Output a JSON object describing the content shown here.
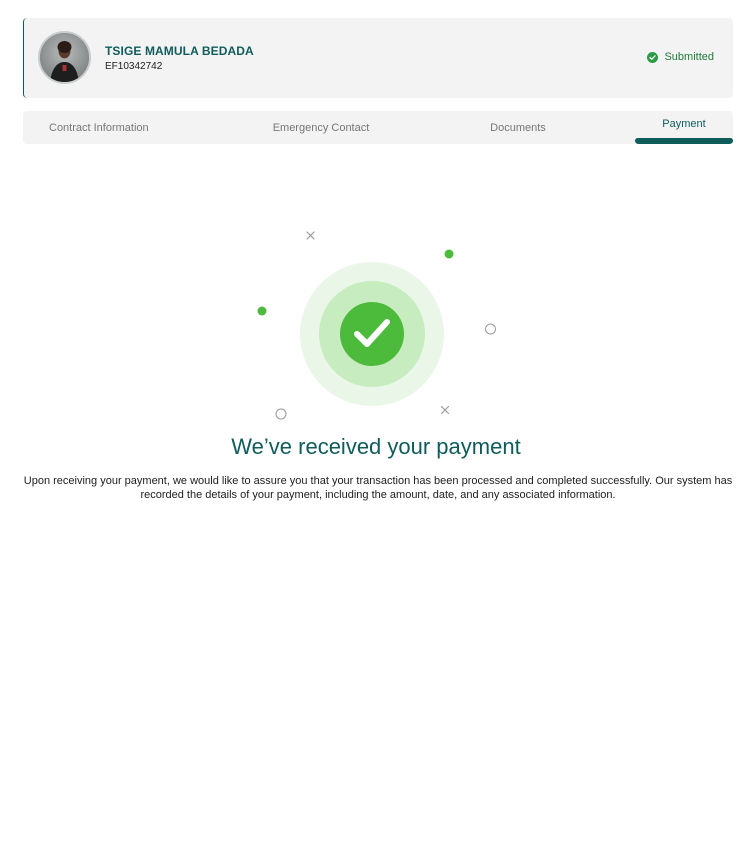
{
  "profile": {
    "name": "TSIGE MAMULA BEDADA",
    "employee_id": "EF10342742",
    "status": "Submitted",
    "status_color": "#2c9b45"
  },
  "tabs": [
    {
      "label": "Contract Information",
      "active": false
    },
    {
      "label": "Emergency Contact",
      "active": false
    },
    {
      "label": "Documents",
      "active": false
    },
    {
      "label": "Payment",
      "active": true
    }
  ],
  "payment": {
    "title": "We’ve received your payment",
    "description": "Upon receiving your payment, we would like to assure you that your transaction has been processed and completed successfully. Our system has recorded the details of your payment, including the amount, date, and any associated information.",
    "icon": "success-check-icon"
  },
  "colors": {
    "accent": "#0f5c5b",
    "success": "#4cbb3b",
    "panel": "#f3f3f3"
  }
}
